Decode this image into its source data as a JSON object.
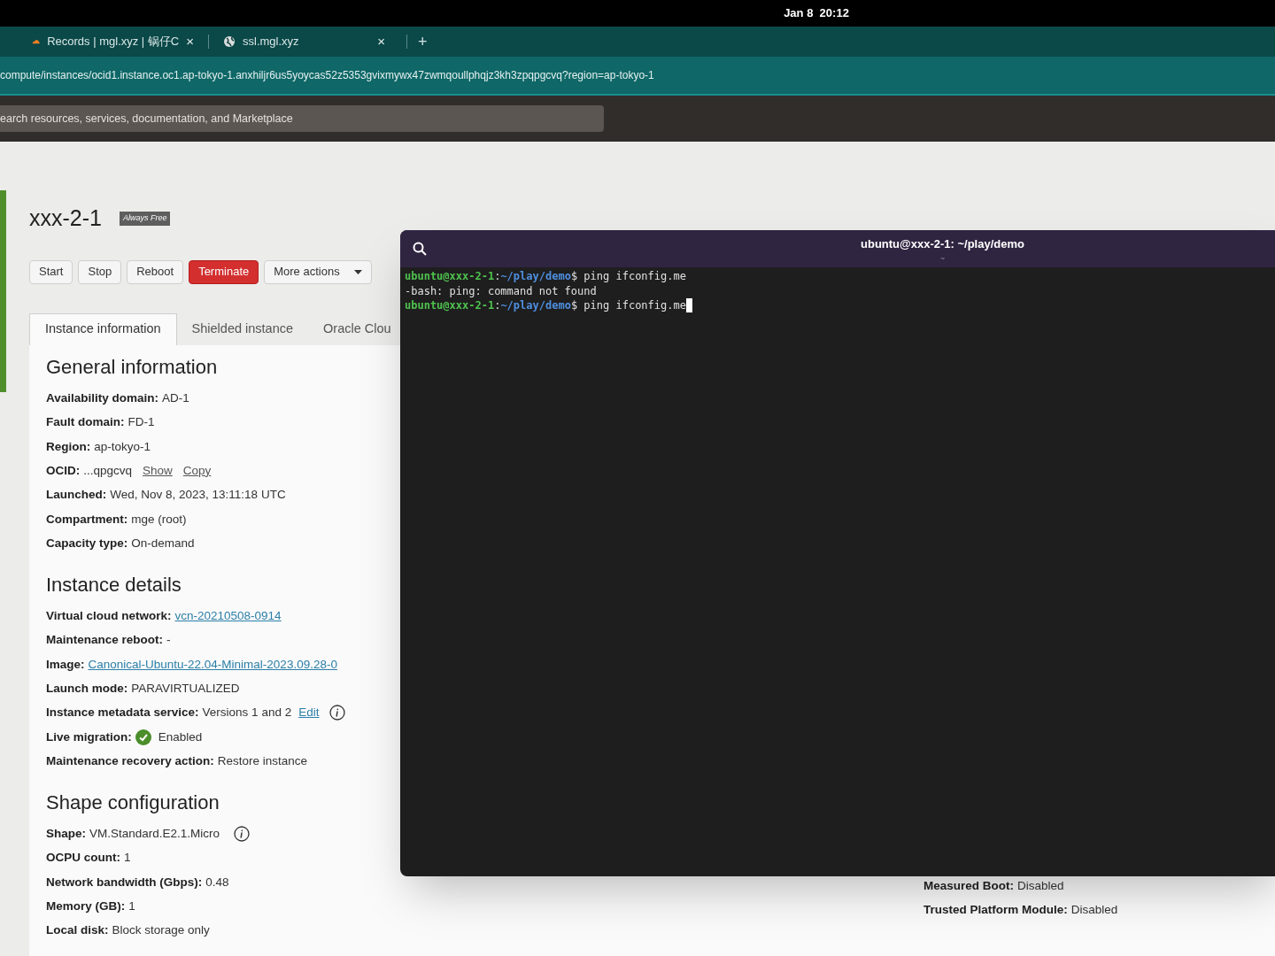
{
  "clock": "Jan 8  20:12",
  "browser_tabs": [
    {
      "title": "Records | mgl.xyz | 锅仔C",
      "kind": "cloud",
      "close": "×",
      "selected": false
    },
    {
      "title": "ssl.mgl.xyz",
      "kind": "globe",
      "close": "×",
      "selected": false
    }
  ],
  "new_tab": "+",
  "url": "compute/instances/ocid1.instance.oc1.ap-tokyo-1.anxhiljr6us5yoycas52z5353gvixmywx47zwmqoullphqjz3kh3zpqpgcvq?region=ap-tokyo-1",
  "search": {
    "placeholder": "earch resources, services, documentation, and Marketplace"
  },
  "instance": {
    "name": "xxx-2-1",
    "badge": "Always Free"
  },
  "actions": [
    {
      "label": "Start",
      "kind": "plain"
    },
    {
      "label": "Stop",
      "kind": "plain"
    },
    {
      "label": "Reboot",
      "kind": "plain"
    },
    {
      "label": "Terminate",
      "kind": "danger"
    },
    {
      "label": "More actions",
      "kind": "menu"
    }
  ],
  "tabs": [
    {
      "label": "Instance information",
      "selected": true
    },
    {
      "label": "Shielded instance",
      "selected": false
    },
    {
      "label": "Oracle Clou",
      "selected": false
    }
  ],
  "sections": [
    {
      "title": "General information",
      "rows": [
        {
          "label": "Availability domain:",
          "parts": [
            {
              "kind": "text",
              "text": "AD-1"
            }
          ]
        },
        {
          "label": "Fault domain:",
          "parts": [
            {
              "kind": "text",
              "text": "FD-1"
            }
          ]
        },
        {
          "label": "Region:",
          "parts": [
            {
              "kind": "text",
              "text": "ap-tokyo-1"
            }
          ]
        },
        {
          "label": "OCID:",
          "parts": [
            {
              "kind": "text",
              "text": "...qpgcvq"
            },
            {
              "kind": "action",
              "text": "Show"
            },
            {
              "kind": "action",
              "text": "Copy"
            }
          ]
        },
        {
          "label": "Launched:",
          "parts": [
            {
              "kind": "text",
              "text": "Wed, Nov 8, 2023, 13:11:18 UTC"
            }
          ]
        },
        {
          "label": "Compartment:",
          "parts": [
            {
              "kind": "text",
              "text": "mge (root)"
            }
          ]
        },
        {
          "label": "Capacity type:",
          "parts": [
            {
              "kind": "text",
              "text": "On-demand"
            }
          ]
        }
      ]
    },
    {
      "title": "Instance details",
      "rows": [
        {
          "label": "Virtual cloud network:",
          "parts": [
            {
              "kind": "link",
              "text": "vcn-20210508-0914"
            }
          ]
        },
        {
          "label": "Maintenance reboot:",
          "parts": [
            {
              "kind": "text",
              "text": "-"
            }
          ]
        },
        {
          "label": "Image:",
          "parts": [
            {
              "kind": "link",
              "text": "Canonical-Ubuntu-22.04-Minimal-2023.09.28-0"
            }
          ]
        },
        {
          "label": "Launch mode:",
          "parts": [
            {
              "kind": "text",
              "text": "PARAVIRTUALIZED"
            }
          ]
        },
        {
          "label": "Instance metadata service:",
          "parts": [
            {
              "kind": "text",
              "text": "Versions 1 and 2"
            },
            {
              "kind": "link",
              "text": "Edit"
            },
            {
              "kind": "info"
            }
          ]
        },
        {
          "label": "Live migration:",
          "parts": [
            {
              "kind": "check"
            },
            {
              "kind": "text",
              "text": "Enabled"
            }
          ]
        },
        {
          "label": "Maintenance recovery action:",
          "parts": [
            {
              "kind": "text",
              "text": "Restore instance"
            }
          ]
        }
      ]
    },
    {
      "title": "Shape configuration",
      "rows": [
        {
          "label": "Shape:",
          "parts": [
            {
              "kind": "text",
              "text": "VM.Standard.E2.1.Micro"
            },
            {
              "kind": "info"
            }
          ]
        },
        {
          "label": "OCPU count:",
          "parts": [
            {
              "kind": "text",
              "text": "1"
            }
          ]
        },
        {
          "label": "Network bandwidth (Gbps):",
          "parts": [
            {
              "kind": "text",
              "text": "0.48"
            }
          ]
        },
        {
          "label": "Memory (GB):",
          "parts": [
            {
              "kind": "text",
              "text": "1"
            }
          ]
        },
        {
          "label": "Local disk:",
          "parts": [
            {
              "kind": "text",
              "text": "Block storage only"
            }
          ]
        }
      ]
    }
  ],
  "side_rows": [
    {
      "label": "Measured Boot:",
      "value": "Disabled"
    },
    {
      "label": "Trusted Platform Module:",
      "value": "Disabled"
    }
  ],
  "terminal": {
    "title": "ubuntu@xxx-2-1: ~/play/demo",
    "subtitle": "~",
    "lines": [
      {
        "kind": "prompt",
        "host": "ubuntu@xxx-2-1",
        "colon": ":",
        "path": "~/play/demo",
        "dollar": "$",
        "command": "ping ifconfig.me",
        "cursor": false
      },
      {
        "kind": "output",
        "text": "-bash: ping: command not found"
      },
      {
        "kind": "prompt",
        "host": "ubuntu@xxx-2-1",
        "colon": ":",
        "path": "~/play/demo",
        "dollar": "$",
        "command": "ping ifconfig.me",
        "cursor": true
      }
    ]
  }
}
